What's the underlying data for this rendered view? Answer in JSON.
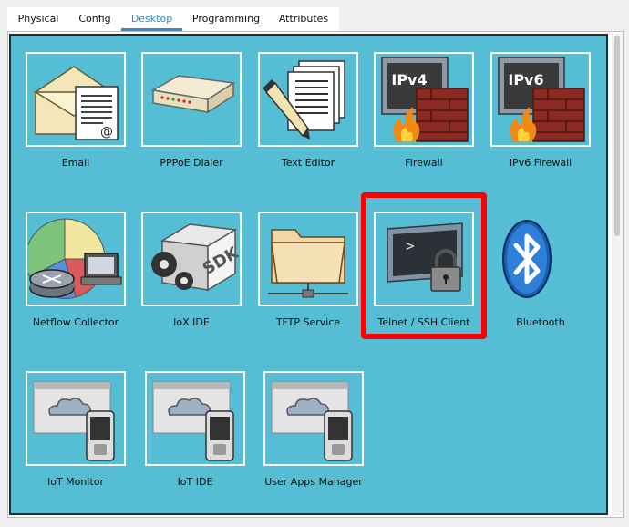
{
  "tabs": [
    {
      "label": "Physical",
      "active": false
    },
    {
      "label": "Config",
      "active": false
    },
    {
      "label": "Desktop",
      "active": true
    },
    {
      "label": "Programming",
      "active": false
    },
    {
      "label": "Attributes",
      "active": false
    }
  ],
  "apps": [
    {
      "label": "Email",
      "icon": "email-icon"
    },
    {
      "label": "PPPoE Dialer",
      "icon": "pppoe-dialer-icon"
    },
    {
      "label": "Text Editor",
      "icon": "text-editor-icon"
    },
    {
      "label": "Firewall",
      "icon": "firewall-icon",
      "badge": "IPv4"
    },
    {
      "label": "IPv6 Firewall",
      "icon": "ipv6-firewall-icon",
      "badge": "IPv6"
    },
    {
      "label": "Netflow Collector",
      "icon": "netflow-collector-icon"
    },
    {
      "label": "IoX IDE",
      "icon": "iox-ide-icon",
      "badge": "SDK"
    },
    {
      "label": "TFTP Service",
      "icon": "tftp-service-icon"
    },
    {
      "label": "Telnet / SSH Client",
      "icon": "telnet-ssh-client-icon",
      "prompt": ">"
    },
    {
      "label": "Bluetooth",
      "icon": "bluetooth-icon"
    },
    {
      "label": "IoT Monitor",
      "icon": "iot-monitor-icon"
    },
    {
      "label": "IoT IDE",
      "icon": "iot-ide-icon"
    },
    {
      "label": "User Apps Manager",
      "icon": "user-apps-manager-icon"
    }
  ],
  "highlighted_app": "Telnet / SSH Client",
  "colors": {
    "desktop_background": "#55bdd4",
    "active_tab": "#2e8ec9",
    "highlight": "#ff0000"
  }
}
